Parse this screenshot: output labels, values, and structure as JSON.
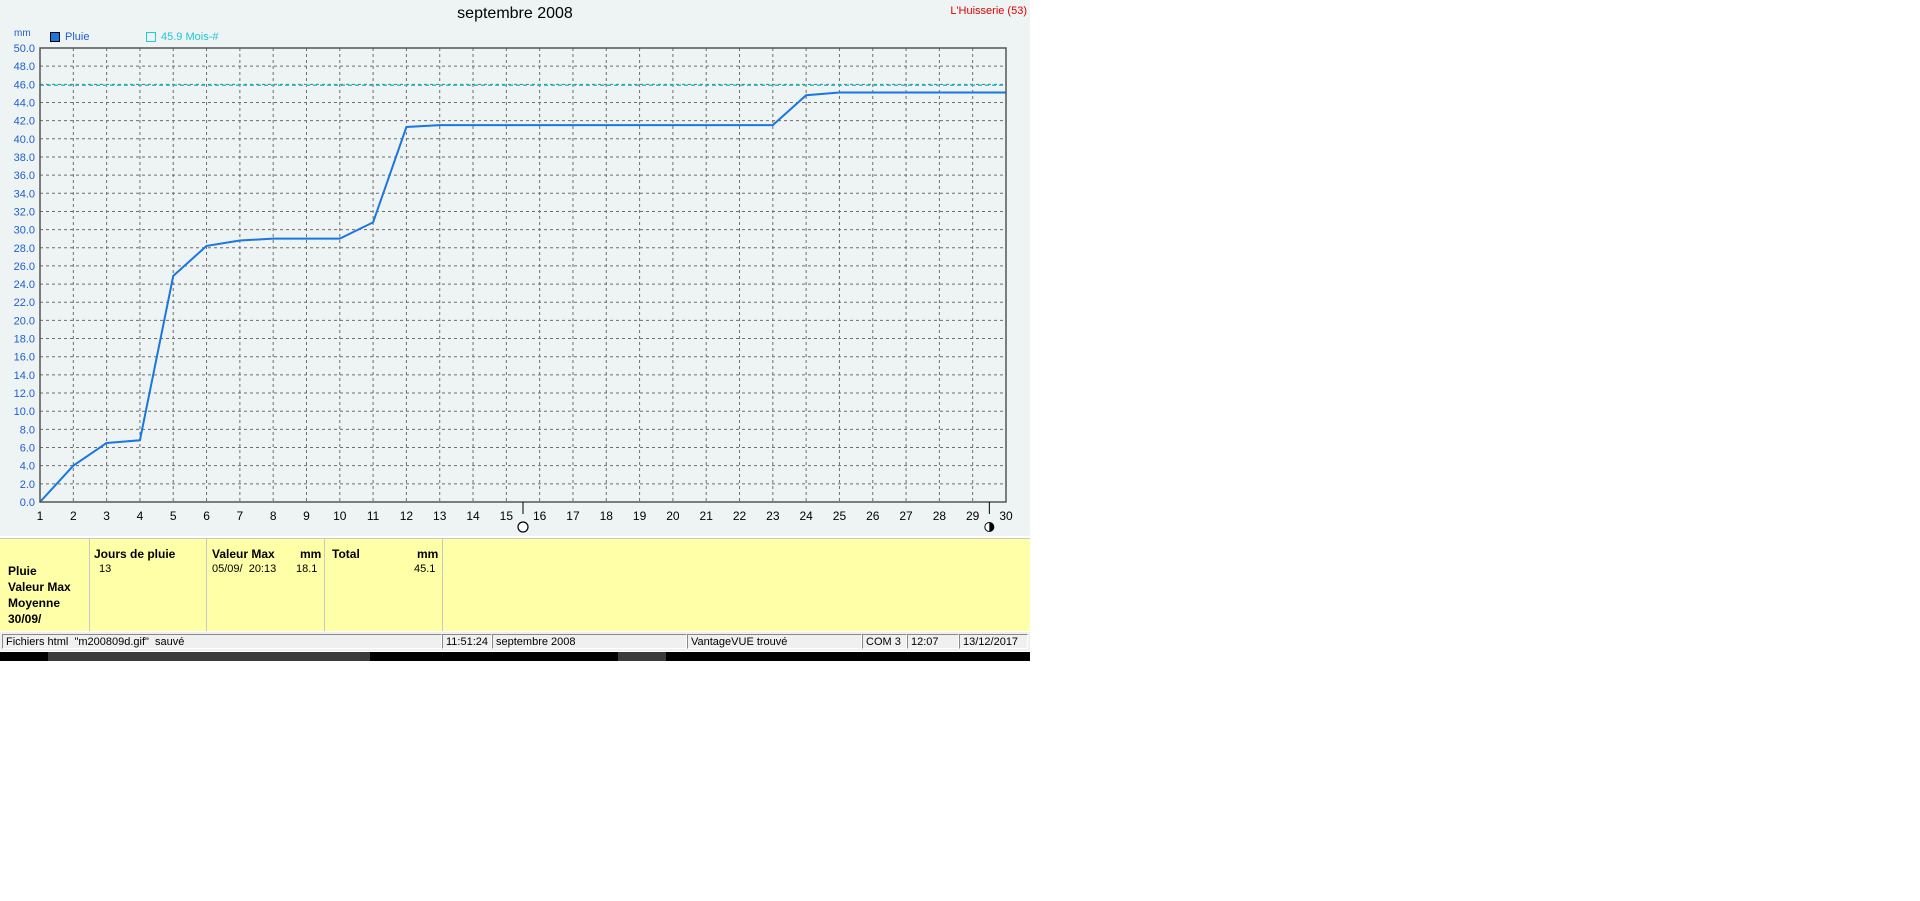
{
  "window": {
    "chart_title": "septembre 2008",
    "station": "L'Huisserie (53)",
    "unit": "mm"
  },
  "legend": {
    "pluie": "Pluie",
    "average": "45.9 Mois-#"
  },
  "colors": {
    "series": "#1a76e0",
    "average": "#20c8d0",
    "axis_text": "#1f5ed1",
    "station": "#e00000",
    "stats_bg": "#ffffa8"
  },
  "chart_data": {
    "type": "line",
    "title": "septembre 2008",
    "ylabel": "mm",
    "xlabel": "",
    "x": [
      1,
      2,
      3,
      4,
      5,
      6,
      7,
      8,
      9,
      10,
      11,
      12,
      13,
      14,
      15,
      16,
      17,
      18,
      19,
      20,
      21,
      22,
      23,
      24,
      25,
      26,
      27,
      28,
      29,
      30
    ],
    "xlim": [
      1,
      30
    ],
    "ylim": [
      0,
      50
    ],
    "ytick_step": 2,
    "grid": true,
    "series": [
      {
        "name": "Pluie",
        "color": "#1a76e0",
        "points": [
          [
            1,
            0
          ],
          [
            2,
            4
          ],
          [
            3,
            6.5
          ],
          [
            4,
            6.8
          ],
          [
            5,
            24.9
          ],
          [
            6,
            28.2
          ],
          [
            7,
            28.8
          ],
          [
            8,
            29
          ],
          [
            9,
            29
          ],
          [
            10,
            29
          ],
          [
            11,
            30.8
          ],
          [
            12,
            41.3
          ],
          [
            13,
            41.5
          ],
          [
            14,
            41.5
          ],
          [
            15,
            41.5
          ],
          [
            16,
            41.5
          ],
          [
            17,
            41.5
          ],
          [
            18,
            41.5
          ],
          [
            19,
            41.5
          ],
          [
            20,
            41.5
          ],
          [
            21,
            41.5
          ],
          [
            22,
            41.5
          ],
          [
            23,
            41.5
          ],
          [
            24,
            44.8
          ],
          [
            25,
            45.1
          ],
          [
            26,
            45.1
          ],
          [
            27,
            45.1
          ],
          [
            28,
            45.1
          ],
          [
            29,
            45.1
          ],
          [
            30,
            45.1
          ]
        ]
      }
    ],
    "reference_line": {
      "name": "45.9 Mois-#",
      "value": 45.9,
      "color": "#20c8d0",
      "style": "dashed"
    },
    "moon_phases": [
      {
        "day": 15.5,
        "phase": "full-moon"
      },
      {
        "day": 29.5,
        "phase": "new-moon"
      }
    ]
  },
  "stats": {
    "row_labels": [
      "Pluie",
      "Valeur Max",
      "Moyenne",
      "30/09/"
    ],
    "jours_header": "Jours de pluie",
    "jours_value": "13",
    "max_header": "Valeur Max",
    "max_unit": "mm",
    "max_date": "05/09/  20:13",
    "max_value": "18.1",
    "total_header": "Total",
    "total_unit": "mm",
    "total_value": "45.1"
  },
  "status_bar": {
    "message": "Fichiers html  \"m200809d.gif\"  sauvé",
    "time1": "11:51:24",
    "period": "septembre 2008",
    "device": "VantageVUE trouvé",
    "port": "COM 3",
    "time2": "12:07",
    "date": "13/12/2017"
  }
}
